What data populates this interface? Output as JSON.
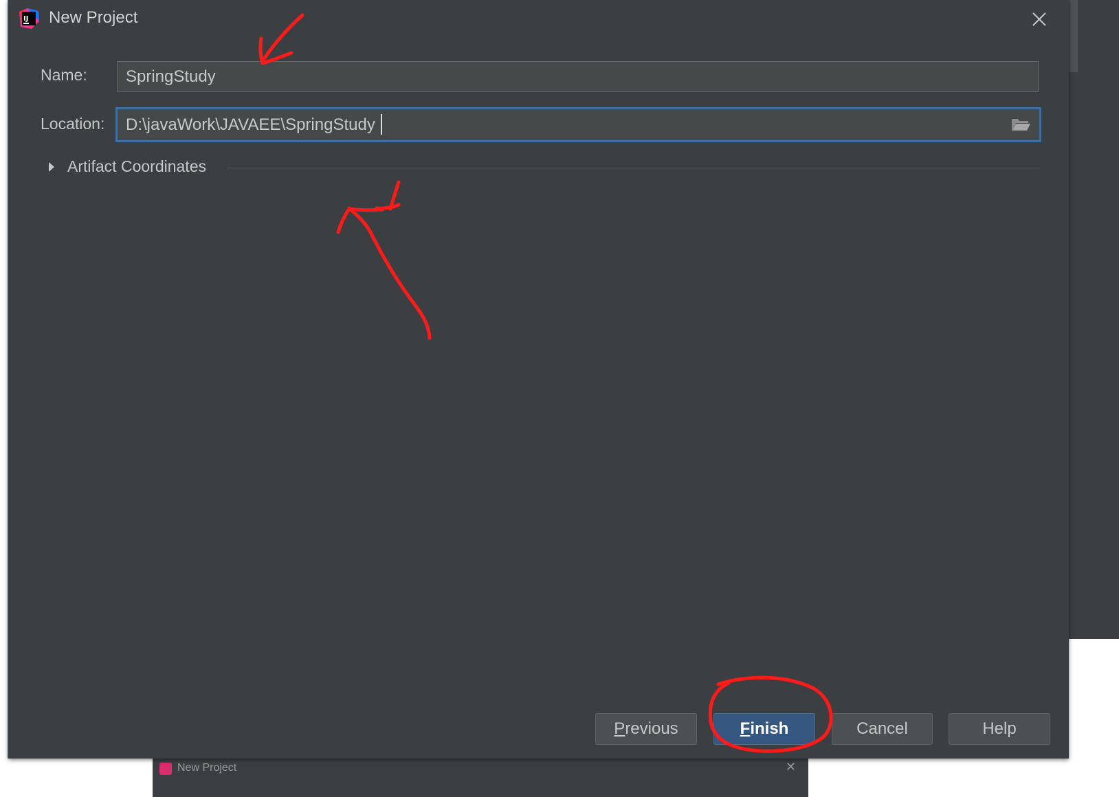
{
  "dialog": {
    "title": "New Project",
    "app_icon": "intellij-idea-icon",
    "close_icon": "close-icon"
  },
  "form": {
    "name_label": "Name:",
    "name_value": "SpringStudy",
    "location_label": "Location:",
    "location_value": "D:\\javaWork\\JAVAEE\\SpringStudy",
    "browse_icon": "folder-icon"
  },
  "artifact": {
    "label": "Artifact Coordinates",
    "expander_icon": "triangle-right-icon",
    "expanded": false
  },
  "buttons": {
    "previous_mnemonic": "P",
    "previous_rest": "revious",
    "finish_mnemonic": "F",
    "finish_rest": "inish",
    "cancel": "Cancel",
    "help": "Help"
  },
  "background_window": {
    "title": "New Project"
  },
  "colors": {
    "dialog_bg": "#3c3f41",
    "field_bg": "#45494a",
    "focus_border": "#3d6fa3",
    "default_button": "#365880",
    "annotation": "#ff1a1a"
  }
}
